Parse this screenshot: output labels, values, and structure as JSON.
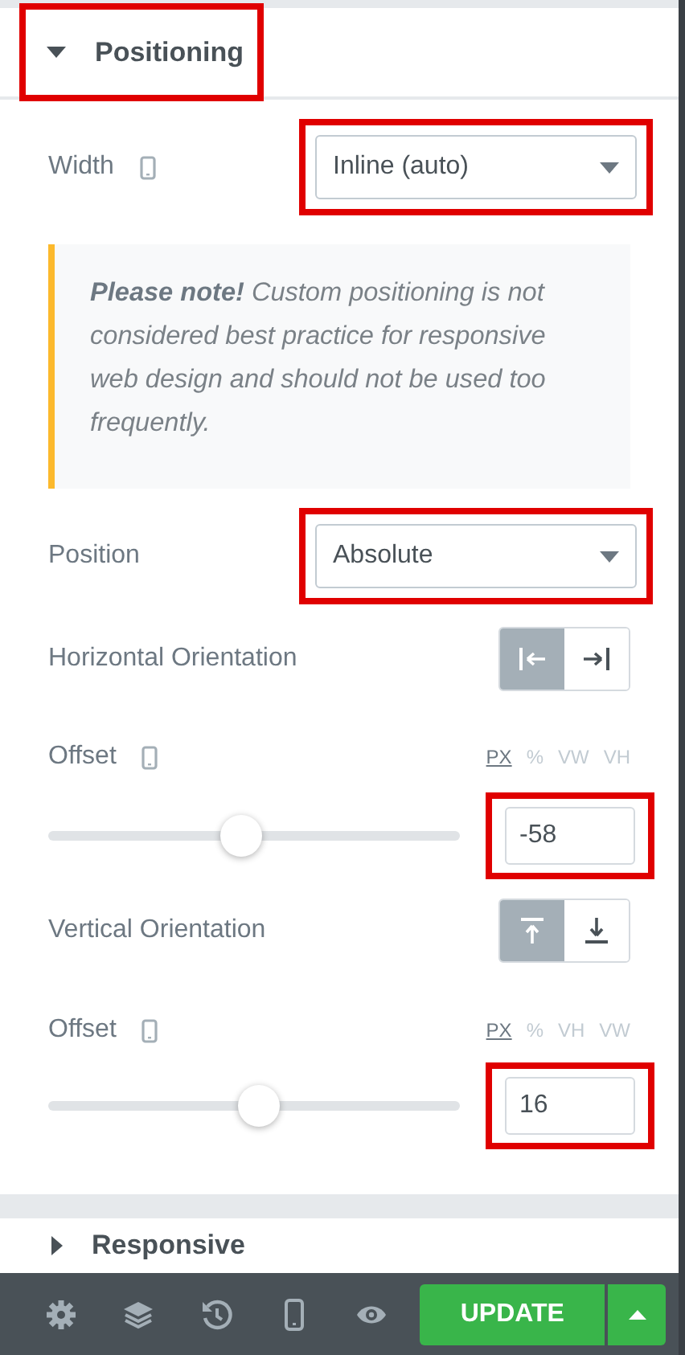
{
  "section": {
    "title": "Positioning",
    "expanded": true,
    "highlighted": true
  },
  "width": {
    "label": "Width",
    "value": "Inline (auto)",
    "highlighted": true
  },
  "note": {
    "text": "**Please note!** Custom positioning is not considered best practice for responsive web design and should not be used too frequently."
  },
  "position": {
    "label": "Position",
    "value": "Absolute",
    "highlighted": true
  },
  "horizontal_orientation": {
    "label": "Horizontal Orientation",
    "options": [
      {
        "kind": "left",
        "selected": true
      },
      {
        "kind": "right",
        "selected": false
      }
    ]
  },
  "horizontal_offset": {
    "label": "Offset",
    "units": [
      {
        "label": "PX",
        "selected": true
      },
      {
        "label": "%",
        "selected": false
      },
      {
        "label": "VW",
        "selected": false
      },
      {
        "label": "VH",
        "selected": false
      }
    ],
    "level": 0.47,
    "value": "-58",
    "highlighted": true
  },
  "vertical_orientation": {
    "label": "Vertical Orientation",
    "options": [
      {
        "kind": "top",
        "selected": true
      },
      {
        "kind": "bottom",
        "selected": false
      }
    ]
  },
  "vertical_offset": {
    "label": "Offset",
    "units": [
      {
        "label": "PX",
        "selected": true
      },
      {
        "label": "%",
        "selected": false
      },
      {
        "label": "VH",
        "selected": false
      },
      {
        "label": "VW",
        "selected": false
      }
    ],
    "level": 0.51,
    "value": "16",
    "highlighted": true
  },
  "next_section": {
    "title": "Responsive",
    "expanded": false
  },
  "footer": {
    "tools": [
      {
        "kind": "settings"
      },
      {
        "kind": "layers"
      },
      {
        "kind": "history"
      },
      {
        "kind": "responsive"
      },
      {
        "kind": "preview"
      }
    ],
    "update_button": "UPDATE"
  }
}
